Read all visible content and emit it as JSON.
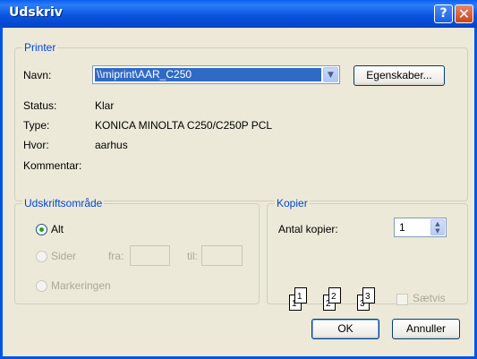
{
  "window": {
    "title": "Udskriv"
  },
  "titlebar": {
    "help_glyph": "?",
    "close_glyph": "✕"
  },
  "printer": {
    "legend": "Printer",
    "name_label": "Navn:",
    "name_value": "\\\\miprint\\AAR_C250",
    "properties_label": "Egenskaber...",
    "status_label": "Status:",
    "status_value": "Klar",
    "type_label": "Type:",
    "type_value": "KONICA MINOLTA C250/C250P PCL",
    "where_label": "Hvor:",
    "where_value": "aarhus",
    "comment_label": "Kommentar:",
    "comment_value": ""
  },
  "print_range": {
    "legend": "Udskriftsområde",
    "all_label": "Alt",
    "pages_label": "Sider",
    "from_label": "fra:",
    "to_label": "til:",
    "from_value": "",
    "to_value": "",
    "selection_label": "Markeringen",
    "selected": "Alt"
  },
  "copies": {
    "legend": "Kopier",
    "count_label": "Antal kopier:",
    "count_value": "1",
    "collate_label": "Sætvis",
    "collate_checked": false,
    "collate_pages": [
      "1",
      "1",
      "2",
      "2",
      "3",
      "3"
    ]
  },
  "buttons": {
    "ok": "OK",
    "cancel": "Annuller"
  },
  "icons": {
    "dropdown": "chevron-down-icon",
    "help": "help-icon",
    "close": "close-icon",
    "spin": "spin-arrows-icon",
    "collate": "collate-pages-icon"
  },
  "colors": {
    "title_bar": "#0054e3",
    "group_legend": "#0046d5",
    "selection": "#316ac5",
    "dialog_bg": "#ece9d8"
  }
}
